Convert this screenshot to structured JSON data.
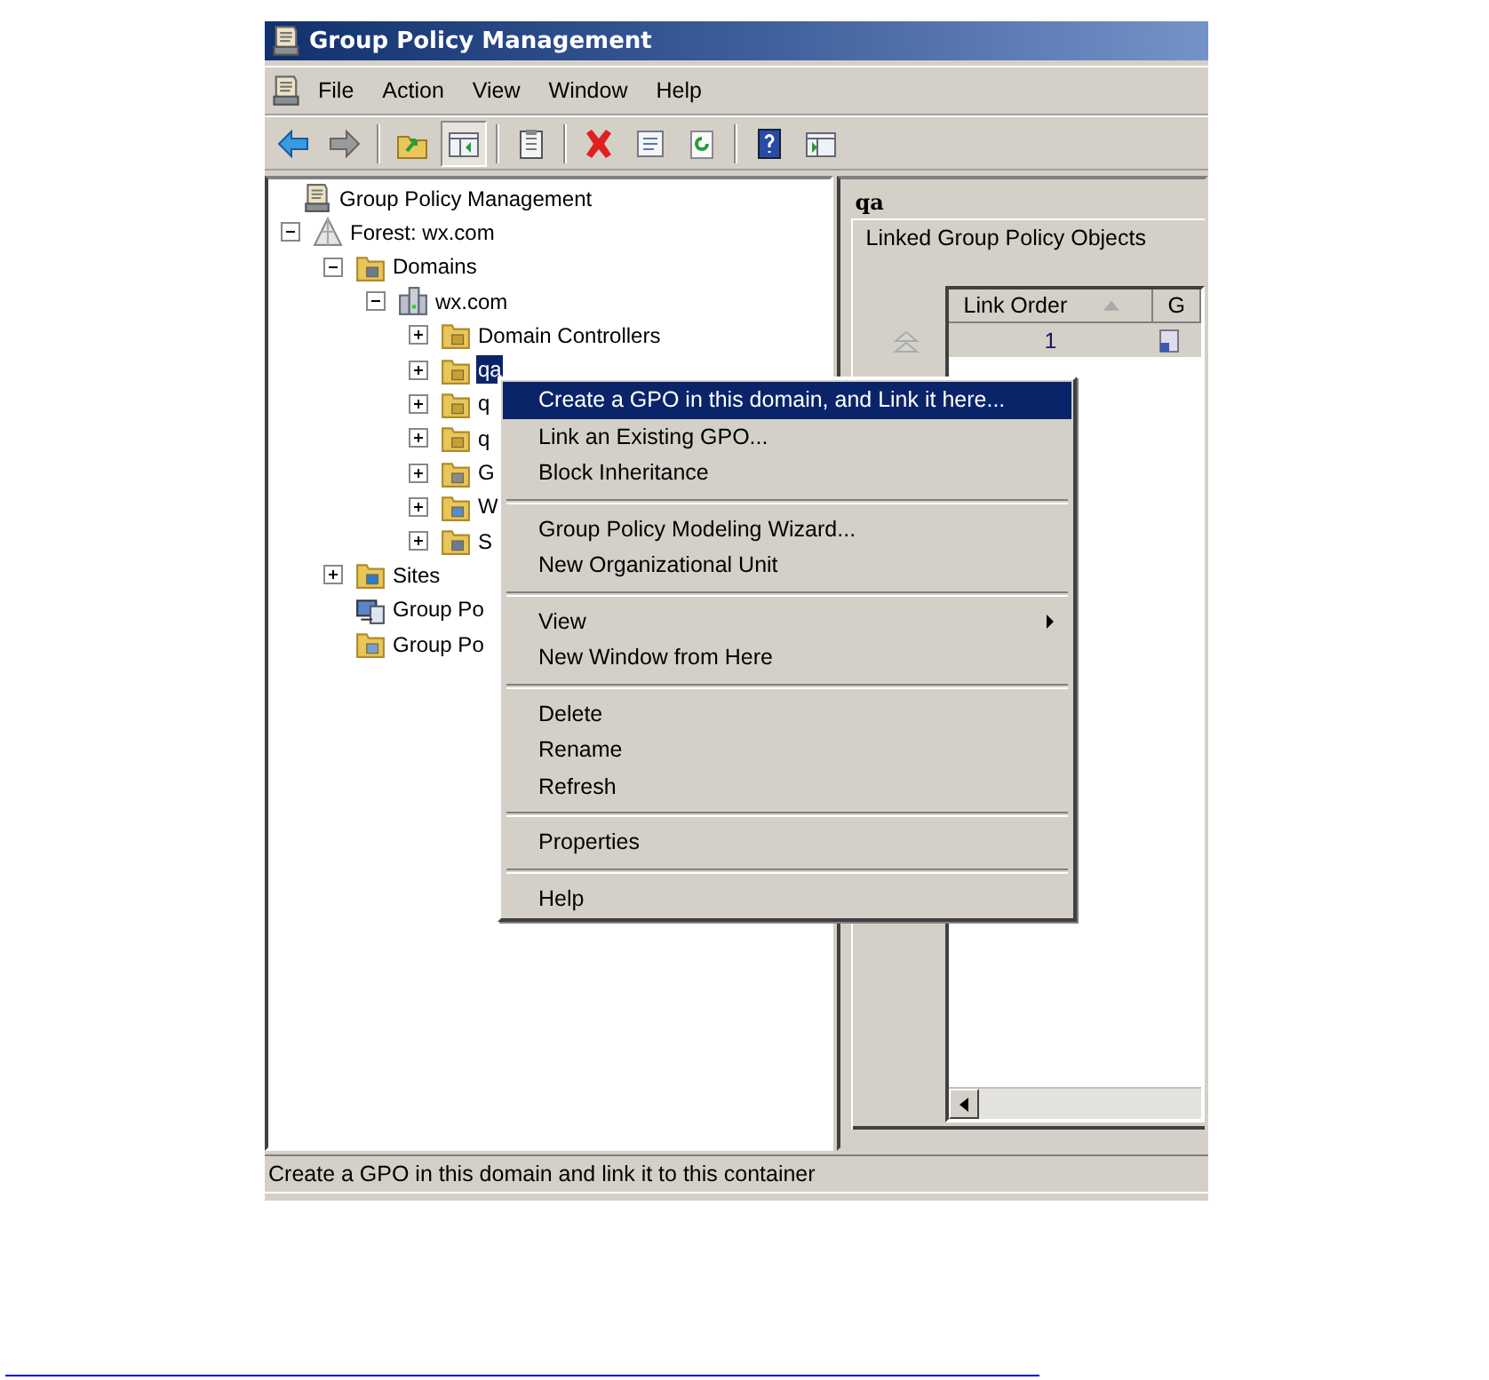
{
  "window": {
    "title": "Group Policy Management"
  },
  "menu_bar": [
    "File",
    "Action",
    "View",
    "Window",
    "Help"
  ],
  "toolbar": [
    {
      "pressed": false
    },
    {
      "pressed": false
    },
    {
      "pressed": false
    },
    {
      "pressed": true
    },
    {
      "pressed": false
    },
    {
      "pressed": false
    },
    {
      "pressed": false
    },
    {
      "pressed": false
    },
    {
      "pressed": false
    },
    {
      "pressed": false
    }
  ],
  "tree": [
    {
      "label": "Group Policy Management",
      "kind": "console",
      "selected": false,
      "children": [
        {
          "label": "Forest: wx.com",
          "kind": "forest",
          "expanded": true,
          "selected": false,
          "children": [
            {
              "label": "Domains",
              "kind": "domains",
              "expanded": true,
              "selected": false,
              "children": [
                {
                  "label": "wx.com",
                  "kind": "domain",
                  "expanded": true,
                  "selected": false,
                  "children": [
                    {
                      "label": "Domain Controllers",
                      "kind": "ou",
                      "expanded": false,
                      "selected": false
                    },
                    {
                      "label": "qa",
                      "kind": "ou",
                      "expanded": false,
                      "selected": true
                    },
                    {
                      "label": "q",
                      "kind": "ou",
                      "expanded": false,
                      "selected": false
                    },
                    {
                      "label": "q",
                      "kind": "ou",
                      "expanded": false,
                      "selected": false
                    },
                    {
                      "label": "G",
                      "kind": "gpo-folder",
                      "expanded": false,
                      "selected": false
                    },
                    {
                      "label": "W",
                      "kind": "filter-folder",
                      "expanded": false,
                      "selected": false
                    },
                    {
                      "label": "S",
                      "kind": "starter-folder",
                      "expanded": false,
                      "selected": false
                    }
                  ]
                }
              ]
            },
            {
              "label": "Sites",
              "kind": "sites",
              "expanded": false,
              "selected": false
            },
            {
              "label": "Group Po",
              "kind": "modeling",
              "selected": false
            },
            {
              "label": "Group Po",
              "kind": "results",
              "selected": false
            }
          ]
        }
      ]
    }
  ],
  "details": {
    "title": "qa",
    "tab": "Linked Group Policy Objects",
    "table": {
      "columns": [
        "Link Order",
        "G"
      ],
      "rows": [
        [
          "1"
        ]
      ]
    }
  },
  "context_menu": [
    [
      {
        "label": "Create a GPO in this domain, and Link it here...",
        "selected": true,
        "submenu": false
      },
      {
        "label": "Link an Existing GPO...",
        "selected": false,
        "submenu": false
      },
      {
        "label": "Block Inheritance",
        "selected": false,
        "submenu": false
      }
    ],
    [
      {
        "label": "Group Policy Modeling Wizard...",
        "selected": false,
        "submenu": false
      },
      {
        "label": "New Organizational Unit",
        "selected": false,
        "submenu": false
      }
    ],
    [
      {
        "label": "View",
        "selected": false,
        "submenu": true
      },
      {
        "label": "New Window from Here",
        "selected": false,
        "submenu": false
      }
    ],
    [
      {
        "label": "Delete",
        "selected": false,
        "submenu": false
      },
      {
        "label": "Rename",
        "selected": false,
        "submenu": false
      },
      {
        "label": "Refresh",
        "selected": false,
        "submenu": false
      }
    ],
    [
      {
        "label": "Properties",
        "selected": false,
        "submenu": false
      }
    ],
    [
      {
        "label": "Help",
        "selected": false,
        "submenu": false
      }
    ]
  ],
  "status_bar": "Create a GPO in this domain and link it to this container"
}
